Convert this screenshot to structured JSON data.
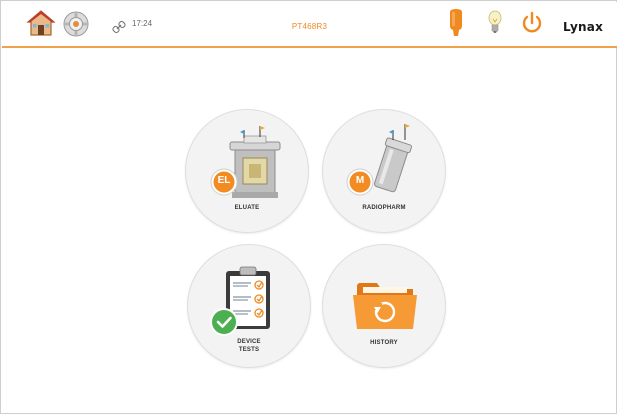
{
  "topbar": {
    "time": "17:24",
    "device_id": "PT468R3",
    "logo_text": "Lynax"
  },
  "tiles": [
    {
      "label": "ELUATE",
      "badge": "EL"
    },
    {
      "label": "RADIOPHARM",
      "badge": "M"
    },
    {
      "label_line1": "DEVICE",
      "label_line2": "TESTS"
    },
    {
      "label": "HISTORY"
    }
  ],
  "colors": {
    "accent": "#f08a1f",
    "badge": "#f28b22",
    "check": "#4caf50",
    "tile_bg": "#f3f3f3"
  },
  "icons": [
    "home-icon",
    "gear-icon",
    "link-icon",
    "probe-icon",
    "bulb-icon",
    "power-icon",
    "check-icon",
    "folder-icon",
    "clipboard-icon"
  ]
}
